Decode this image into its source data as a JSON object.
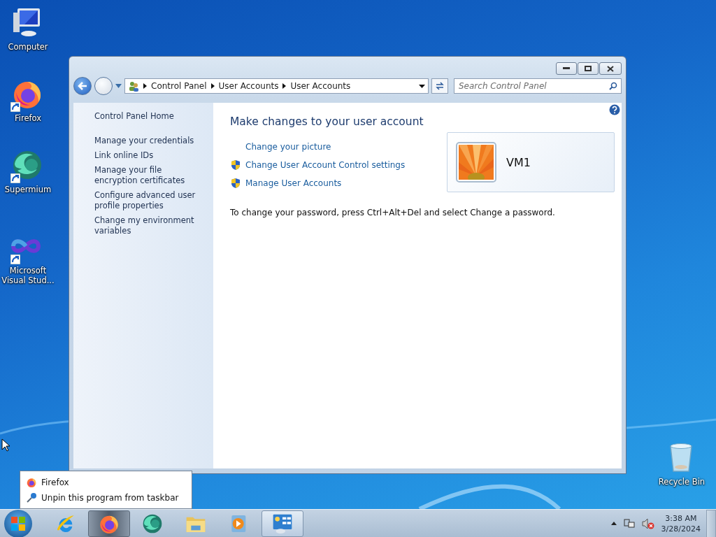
{
  "desktop_icons": [
    {
      "label": "Computer",
      "kind": "computer",
      "shortcut": false
    },
    {
      "label": "Firefox",
      "kind": "firefox",
      "shortcut": true
    },
    {
      "label": "Supermium",
      "kind": "supermium",
      "shortcut": true
    },
    {
      "label": "Microsoft Visual Stud...",
      "kind": "visualstudio",
      "shortcut": true
    },
    {
      "label": "Recycle Bin",
      "kind": "recyclebin",
      "shortcut": false
    }
  ],
  "window": {
    "address": {
      "crumbs": [
        "Control Panel",
        "User Accounts",
        "User Accounts"
      ]
    },
    "search": {
      "placeholder": "Search Control Panel"
    },
    "sidebar": {
      "home": "Control Panel Home",
      "links": [
        "Manage your credentials",
        "Link online IDs",
        "Manage your file encryption certificates",
        "Configure advanced user profile properties",
        "Change my environment variables"
      ]
    },
    "main": {
      "heading": "Make changes to your user account",
      "tasks": [
        {
          "label": "Change your picture",
          "shield": false
        },
        {
          "label": "Change User Account Control settings",
          "shield": true
        },
        {
          "label": "Manage User Accounts",
          "shield": true
        }
      ],
      "account": {
        "name": "VM1"
      },
      "note": "To change your password, press Ctrl+Alt+Del and select Change a password."
    }
  },
  "jump_list": {
    "items": [
      {
        "label": "Firefox",
        "kind": "firefox"
      },
      {
        "label": "Unpin this program from taskbar",
        "kind": "unpin"
      }
    ]
  },
  "taskbar": {
    "buttons": [
      {
        "kind": "ie",
        "highlighted": false,
        "open": false
      },
      {
        "kind": "firefox",
        "highlighted": true,
        "open": false
      },
      {
        "kind": "supermium",
        "highlighted": false,
        "open": false
      },
      {
        "kind": "explorer",
        "highlighted": false,
        "open": false
      },
      {
        "kind": "media",
        "highlighted": false,
        "open": false
      },
      {
        "kind": "controlpanel",
        "highlighted": false,
        "open": true
      }
    ],
    "tray": {
      "time": "3:38 AM",
      "date": "3/28/2024"
    }
  }
}
